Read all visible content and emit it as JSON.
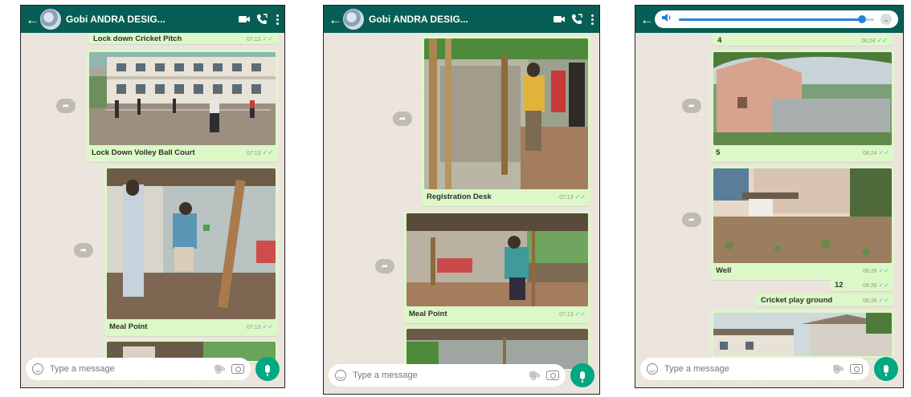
{
  "phones": [
    {
      "chat_title": "Gobi ANDRA DESIG...",
      "input_placeholder": "Type a message",
      "messages": [
        {
          "caption": "Lock down Cricket Pitch",
          "time": "07:13"
        },
        {
          "caption": "Lock Down Volley Ball Court",
          "time": "07:13"
        },
        {
          "caption": "Meal Point",
          "time": "07:13"
        }
      ]
    },
    {
      "chat_title": "Gobi ANDRA DESIG...",
      "input_placeholder": "Type a message",
      "messages": [
        {
          "caption": "Registration Desk",
          "time": "07:13"
        },
        {
          "caption": "Meal Point",
          "time": "07:13"
        }
      ]
    },
    {
      "input_placeholder": "Type a message",
      "audio_progress": 0.94,
      "messages": [
        {
          "caption": "4",
          "time": "06:24"
        },
        {
          "caption": "5",
          "time": "06:24"
        },
        {
          "caption": "Well",
          "time": "06:26"
        },
        {
          "caption": "12",
          "time": "06:26"
        },
        {
          "caption": "Cricket play ground",
          "time": "06:26"
        }
      ]
    }
  ],
  "colors": {
    "header": "#075e54",
    "bubble_out": "#dcf8c6",
    "chat_bg": "#ece5dd",
    "fab": "#00a884",
    "tick": "#4fb6ec"
  }
}
